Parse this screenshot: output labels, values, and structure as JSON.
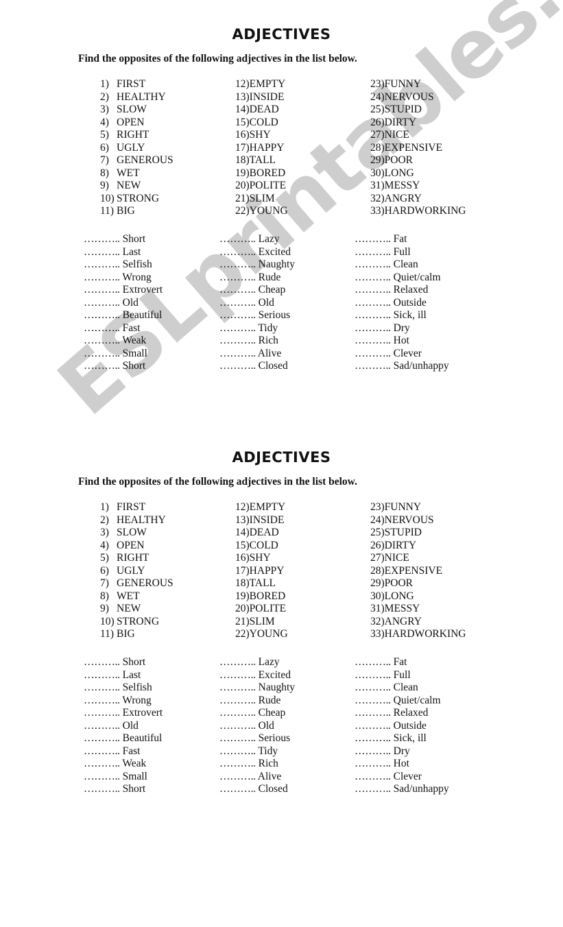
{
  "watermark": "ESLprintables.com",
  "worksheets": [
    {
      "title": "ADJECTIVES",
      "instruction": "Find the opposites of the following adjectives in the list below.",
      "adjectives": [
        [
          {
            "n": "1)",
            "w": "FIRST"
          },
          {
            "n": "2)",
            "w": "HEALTHY"
          },
          {
            "n": "3)",
            "w": "SLOW"
          },
          {
            "n": "4)",
            "w": "OPEN"
          },
          {
            "n": "5)",
            "w": "RIGHT"
          },
          {
            "n": "6)",
            "w": "UGLY"
          },
          {
            "n": "7)",
            "w": "GENEROUS"
          },
          {
            "n": "8)",
            "w": "WET"
          },
          {
            "n": "9)",
            "w": "NEW"
          },
          {
            "n": "10)",
            "w": "STRONG"
          },
          {
            "n": "11)",
            "w": "BIG"
          }
        ],
        [
          {
            "n": "12)",
            "w": "EMPTY"
          },
          {
            "n": "13)",
            "w": "INSIDE"
          },
          {
            "n": "14)",
            "w": "DEAD"
          },
          {
            "n": "15)",
            "w": "COLD"
          },
          {
            "n": "16)",
            "w": "SHY"
          },
          {
            "n": "17)",
            "w": "HAPPY"
          },
          {
            "n": "18)",
            "w": "TALL"
          },
          {
            "n": "19)",
            "w": "BORED"
          },
          {
            "n": "20)",
            "w": "POLITE"
          },
          {
            "n": "21)",
            "w": "SLIM"
          },
          {
            "n": "22)",
            "w": "YOUNG"
          }
        ],
        [
          {
            "n": "23)",
            "w": "FUNNY"
          },
          {
            "n": "24)",
            "w": "NERVOUS"
          },
          {
            "n": "25)",
            "w": "STUPID"
          },
          {
            "n": "26)",
            "w": "DIRTY"
          },
          {
            "n": "27)",
            "w": "NICE"
          },
          {
            "n": "28)",
            "w": "EXPENSIVE"
          },
          {
            "n": "29)",
            "w": "POOR"
          },
          {
            "n": "30)",
            "w": "LONG"
          },
          {
            "n": "31)",
            "w": "MESSY"
          },
          {
            "n": "32)",
            "w": "ANGRY"
          },
          {
            "n": "33)",
            "w": "HARDWORKING"
          }
        ]
      ],
      "blank": "………..",
      "opposites": [
        [
          "Short",
          "Last",
          "Selfish",
          "Wrong",
          "Extrovert",
          "Old",
          "Beautiful",
          "Fast",
          "Weak",
          "Small",
          "Short"
        ],
        [
          "Lazy",
          "Excited",
          "Naughty",
          "Rude",
          "Cheap",
          "Old",
          "Serious",
          "Tidy",
          "Rich",
          "Alive",
          "Closed"
        ],
        [
          "Fat",
          "Full",
          "Clean",
          "Quiet/calm",
          "Relaxed",
          "Outside",
          "Sick, ill",
          "Dry",
          "Hot",
          "Clever",
          "Sad/unhappy"
        ]
      ]
    },
    {
      "title": "ADJECTIVES",
      "instruction": "Find the opposites of the following adjectives in the list below.",
      "adjectives": [
        [
          {
            "n": "1)",
            "w": "FIRST"
          },
          {
            "n": "2)",
            "w": "HEALTHY"
          },
          {
            "n": "3)",
            "w": "SLOW"
          },
          {
            "n": "4)",
            "w": "OPEN"
          },
          {
            "n": "5)",
            "w": "RIGHT"
          },
          {
            "n": "6)",
            "w": "UGLY"
          },
          {
            "n": "7)",
            "w": "GENEROUS"
          },
          {
            "n": "8)",
            "w": "WET"
          },
          {
            "n": "9)",
            "w": "NEW"
          },
          {
            "n": "10)",
            "w": "STRONG"
          },
          {
            "n": "11)",
            "w": "BIG"
          }
        ],
        [
          {
            "n": "12)",
            "w": "EMPTY"
          },
          {
            "n": "13)",
            "w": "INSIDE"
          },
          {
            "n": "14)",
            "w": "DEAD"
          },
          {
            "n": "15)",
            "w": "COLD"
          },
          {
            "n": "16)",
            "w": "SHY"
          },
          {
            "n": "17)",
            "w": "HAPPY"
          },
          {
            "n": "18)",
            "w": "TALL"
          },
          {
            "n": "19)",
            "w": "BORED"
          },
          {
            "n": "20)",
            "w": "POLITE"
          },
          {
            "n": "21)",
            "w": "SLIM"
          },
          {
            "n": "22)",
            "w": "YOUNG"
          }
        ],
        [
          {
            "n": "23)",
            "w": "FUNNY"
          },
          {
            "n": "24)",
            "w": "NERVOUS"
          },
          {
            "n": "25)",
            "w": "STUPID"
          },
          {
            "n": "26)",
            "w": "DIRTY"
          },
          {
            "n": "27)",
            "w": "NICE"
          },
          {
            "n": "28)",
            "w": "EXPENSIVE"
          },
          {
            "n": "29)",
            "w": "POOR"
          },
          {
            "n": "30)",
            "w": "LONG"
          },
          {
            "n": "31)",
            "w": "MESSY"
          },
          {
            "n": "32)",
            "w": "ANGRY"
          },
          {
            "n": "33)",
            "w": "HARDWORKING"
          }
        ]
      ],
      "blank": "………..",
      "opposites": [
        [
          "Short",
          "Last",
          "Selfish",
          "Wrong",
          "Extrovert",
          "Old",
          "Beautiful",
          "Fast",
          "Weak",
          "Small",
          "Short"
        ],
        [
          "Lazy",
          "Excited",
          "Naughty",
          "Rude",
          "Cheap",
          "Old",
          "Serious",
          "Tidy",
          "Rich",
          "Alive",
          "Closed"
        ],
        [
          "Fat",
          "Full",
          "Clean",
          "Quiet/calm",
          "Relaxed",
          "Outside",
          "Sick, ill",
          "Dry",
          "Hot",
          "Clever",
          "Sad/unhappy"
        ]
      ]
    }
  ]
}
